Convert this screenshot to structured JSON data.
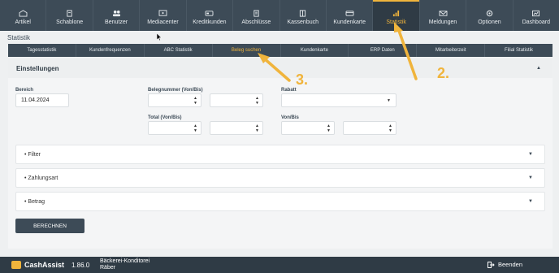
{
  "topnav": {
    "items": [
      {
        "label": "Artikel",
        "icon": "artikel-icon"
      },
      {
        "label": "Schablone",
        "icon": "schablone-icon"
      },
      {
        "label": "Benutzer",
        "icon": "users-icon"
      },
      {
        "label": "Mediacenter",
        "icon": "media-icon"
      },
      {
        "label": "Kreditkunden",
        "icon": "card-icon"
      },
      {
        "label": "Abschlüsse",
        "icon": "document-icon"
      },
      {
        "label": "Kassenbuch",
        "icon": "book-icon"
      },
      {
        "label": "Kundenkarte",
        "icon": "customer-card-icon"
      },
      {
        "label": "Statistik",
        "icon": "chart-icon",
        "active": true
      },
      {
        "label": "Meldungen",
        "icon": "mail-icon"
      },
      {
        "label": "Optionen",
        "icon": "gear-icon"
      },
      {
        "label": "Dashboard",
        "icon": "dashboard-icon"
      }
    ]
  },
  "page": {
    "title": "Statistik"
  },
  "subtabs": {
    "items": [
      "Tagesstatistik",
      "Kundenfrequenzen",
      "ABC Statistik",
      "Beleg suchen",
      "Kundenkarte",
      "ERP Daten",
      "Mitarbeiterzeit",
      "Filial Statistik"
    ],
    "active": "Beleg suchen"
  },
  "settings": {
    "title": "Einstellungen",
    "bereich_label": "Bereich",
    "bereich_value": "11.04.2024",
    "belegnummer_label": "Belegnummer (Von/Bis)",
    "total_label": "Total (Von/Bis)",
    "rabatt_label": "Rabatt",
    "vonbis_label": "Von/Bis",
    "accordions": [
      "Filter",
      "Zahlungsart",
      "Betrag"
    ],
    "calculate_label": "BERECHNEN"
  },
  "footer": {
    "brand": "CashAssist",
    "version": "1.86.0",
    "company": "Bäckerei-Konditorei Räber",
    "logout_label": "Beenden"
  },
  "annotations": {
    "step2": "2.",
    "step3": "3."
  },
  "colors": {
    "nav": "#3d4b57",
    "accent": "#f0b43c",
    "bottombar": "#2f3b45"
  }
}
